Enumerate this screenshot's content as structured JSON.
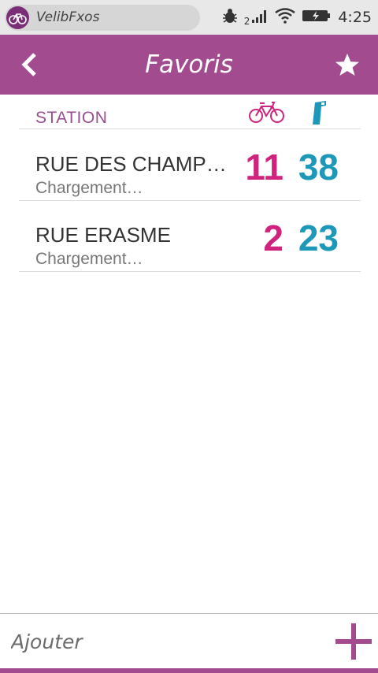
{
  "statusbar": {
    "app_name": "VelibFxos",
    "signal_sim": "2",
    "time": "4:25"
  },
  "header": {
    "title": "Favoris"
  },
  "columns": {
    "station": "STATION"
  },
  "stations": [
    {
      "name": "RUE DES CHAMPEAUX",
      "status": "Chargement…",
      "bikes": "11",
      "stands": "38"
    },
    {
      "name": "RUE ERASME",
      "status": "Chargement…",
      "bikes": "2",
      "stands": "23"
    }
  ],
  "footer": {
    "placeholder": "Ajouter"
  },
  "colors": {
    "brand": "#a24b8f",
    "bikes": "#d0237e",
    "stands": "#1d98b8"
  },
  "icons": {
    "back": "chevron-left-icon",
    "favorite": "star-icon",
    "add": "plus-icon",
    "bike": "bicycle-icon",
    "stand": "parking-stand-icon"
  }
}
